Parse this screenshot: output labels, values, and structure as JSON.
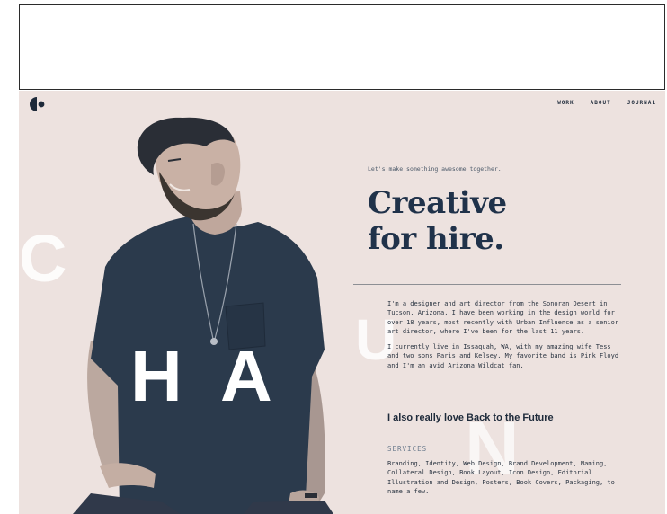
{
  "nav": [
    "WORK",
    "ABOUT",
    "JOURNAL"
  ],
  "letters": [
    "C",
    "H",
    "A",
    "U",
    "N"
  ],
  "tagline": "Let's make something awesome together.",
  "headline": [
    "Creative",
    "for hire."
  ],
  "bio": [
    "I'm a designer and art director from the Sonoran Desert in Tucson, Arizona. I have been working in the design world for over 18 years, most recently with Urban Influence as a senior art director, where I've been for the last 11 years.",
    "I currently live in Issaquah, WA, with my amazing wife Tess and two sons Paris and Kelsey. My favorite band is Pink Floyd and I'm an avid Arizona Wildcat fan."
  ],
  "love_line": "I also really love Back to the Future",
  "services_heading": "SERVICES",
  "services_text": "Branding, Identity, Web Design, Brand Development, Naming, Collateral Design, Book Layout, Icon Design, Editorial Illustration and Design, Posters, Book Covers, Packaging, to name a few.",
  "colors": {
    "background": "#ede2df",
    "navy": "#20324a",
    "shirt": "#2b3a4c"
  }
}
